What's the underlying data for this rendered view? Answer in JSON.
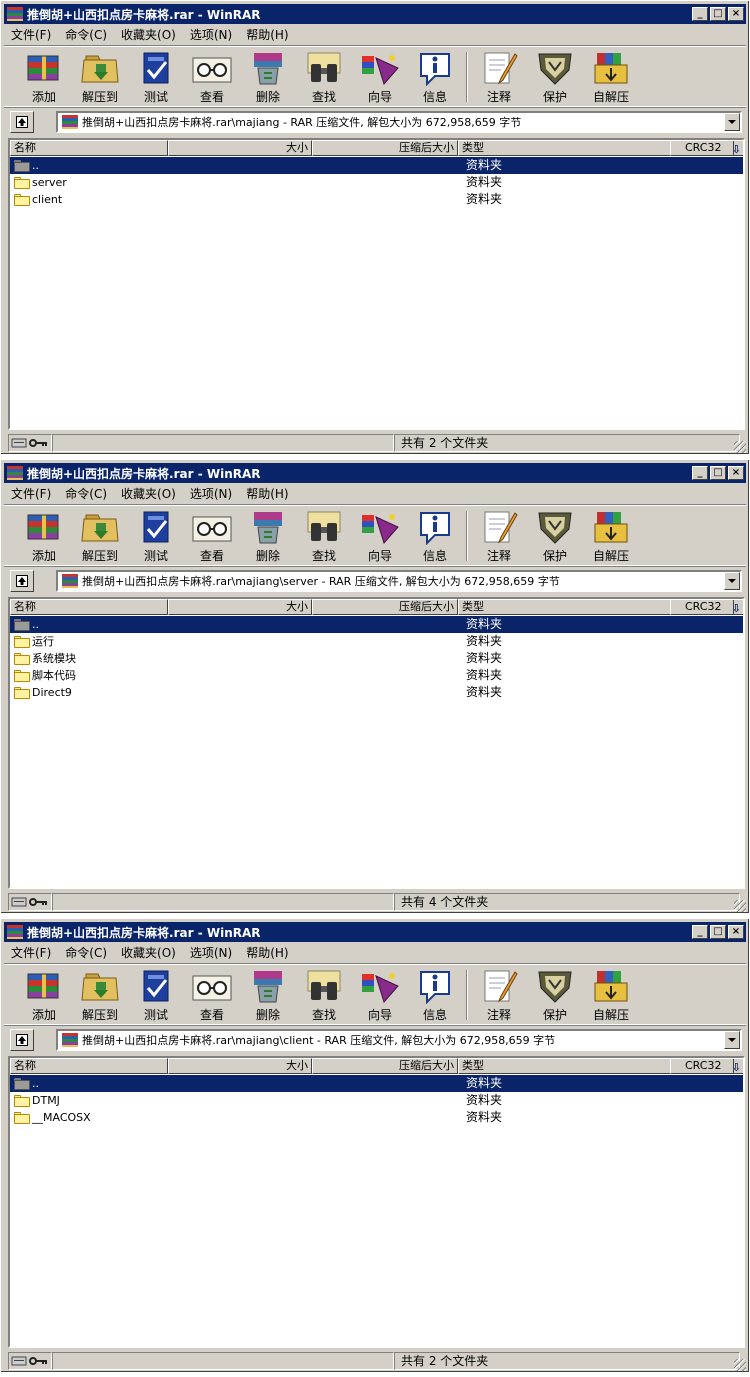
{
  "colors": {
    "title_bg": "#0a246a",
    "window_bg": "#d4d0c8",
    "selection": "#0a246a",
    "folder_fill": "#fff2a0",
    "folder_stroke": "#b58a00"
  },
  "menu": [
    "文件(F)",
    "命令(C)",
    "收藏夹(O)",
    "选项(N)",
    "帮助(H)"
  ],
  "toolbar": [
    {
      "label": "添加",
      "icon": "add-archive-icon"
    },
    {
      "label": "解压到",
      "icon": "extract-to-icon"
    },
    {
      "label": "测试",
      "icon": "test-archive-icon"
    },
    {
      "label": "查看",
      "icon": "view-glasses-icon"
    },
    {
      "label": "删除",
      "icon": "delete-recycle-icon"
    },
    {
      "label": "查找",
      "icon": "find-binoculars-icon"
    },
    {
      "label": "向导",
      "icon": "wizard-icon"
    },
    {
      "label": "信息",
      "icon": "info-icon"
    },
    {
      "label": "注释",
      "icon": "comment-pen-icon"
    },
    {
      "label": "保护",
      "icon": "protect-shield-icon"
    },
    {
      "label": "自解压",
      "icon": "sfx-box-icon"
    }
  ],
  "columns": {
    "name": "名称",
    "size": "大小",
    "packed": "压缩后大小",
    "type": "类型",
    "crc": "CRC32"
  },
  "windows": [
    {
      "title": "推倒胡+山西扣点房卡麻将.rar - WinRAR",
      "address": "推倒胡+山西扣点房卡麻将.rar\\majiang - RAR 压缩文件, 解包大小为 672,958,659 字节",
      "rows": [
        {
          "name": "..",
          "type": "资料夹",
          "selected": true
        },
        {
          "name": "server",
          "type": "资料夹",
          "selected": false
        },
        {
          "name": "client",
          "type": "资料夹",
          "selected": false
        }
      ],
      "status": "共有 2 个文件夹"
    },
    {
      "title": "推倒胡+山西扣点房卡麻将.rar - WinRAR",
      "address": "推倒胡+山西扣点房卡麻将.rar\\majiang\\server - RAR 压缩文件, 解包大小为 672,958,659 字节",
      "rows": [
        {
          "name": "..",
          "type": "资料夹",
          "selected": true
        },
        {
          "name": "运行",
          "type": "资料夹",
          "selected": false
        },
        {
          "name": "系统模块",
          "type": "资料夹",
          "selected": false
        },
        {
          "name": "脚本代码",
          "type": "资料夹",
          "selected": false
        },
        {
          "name": "Direct9",
          "type": "资料夹",
          "selected": false
        }
      ],
      "status": "共有 4 个文件夹"
    },
    {
      "title": "推倒胡+山西扣点房卡麻将.rar - WinRAR",
      "address": "推倒胡+山西扣点房卡麻将.rar\\majiang\\client - RAR 压缩文件, 解包大小为 672,958,659 字节",
      "rows": [
        {
          "name": "..",
          "type": "资料夹",
          "selected": true
        },
        {
          "name": "DTMJ",
          "type": "资料夹",
          "selected": false
        },
        {
          "name": "__MACOSX",
          "type": "资料夹",
          "selected": false
        }
      ],
      "status": "共有 2 个文件夹"
    }
  ]
}
